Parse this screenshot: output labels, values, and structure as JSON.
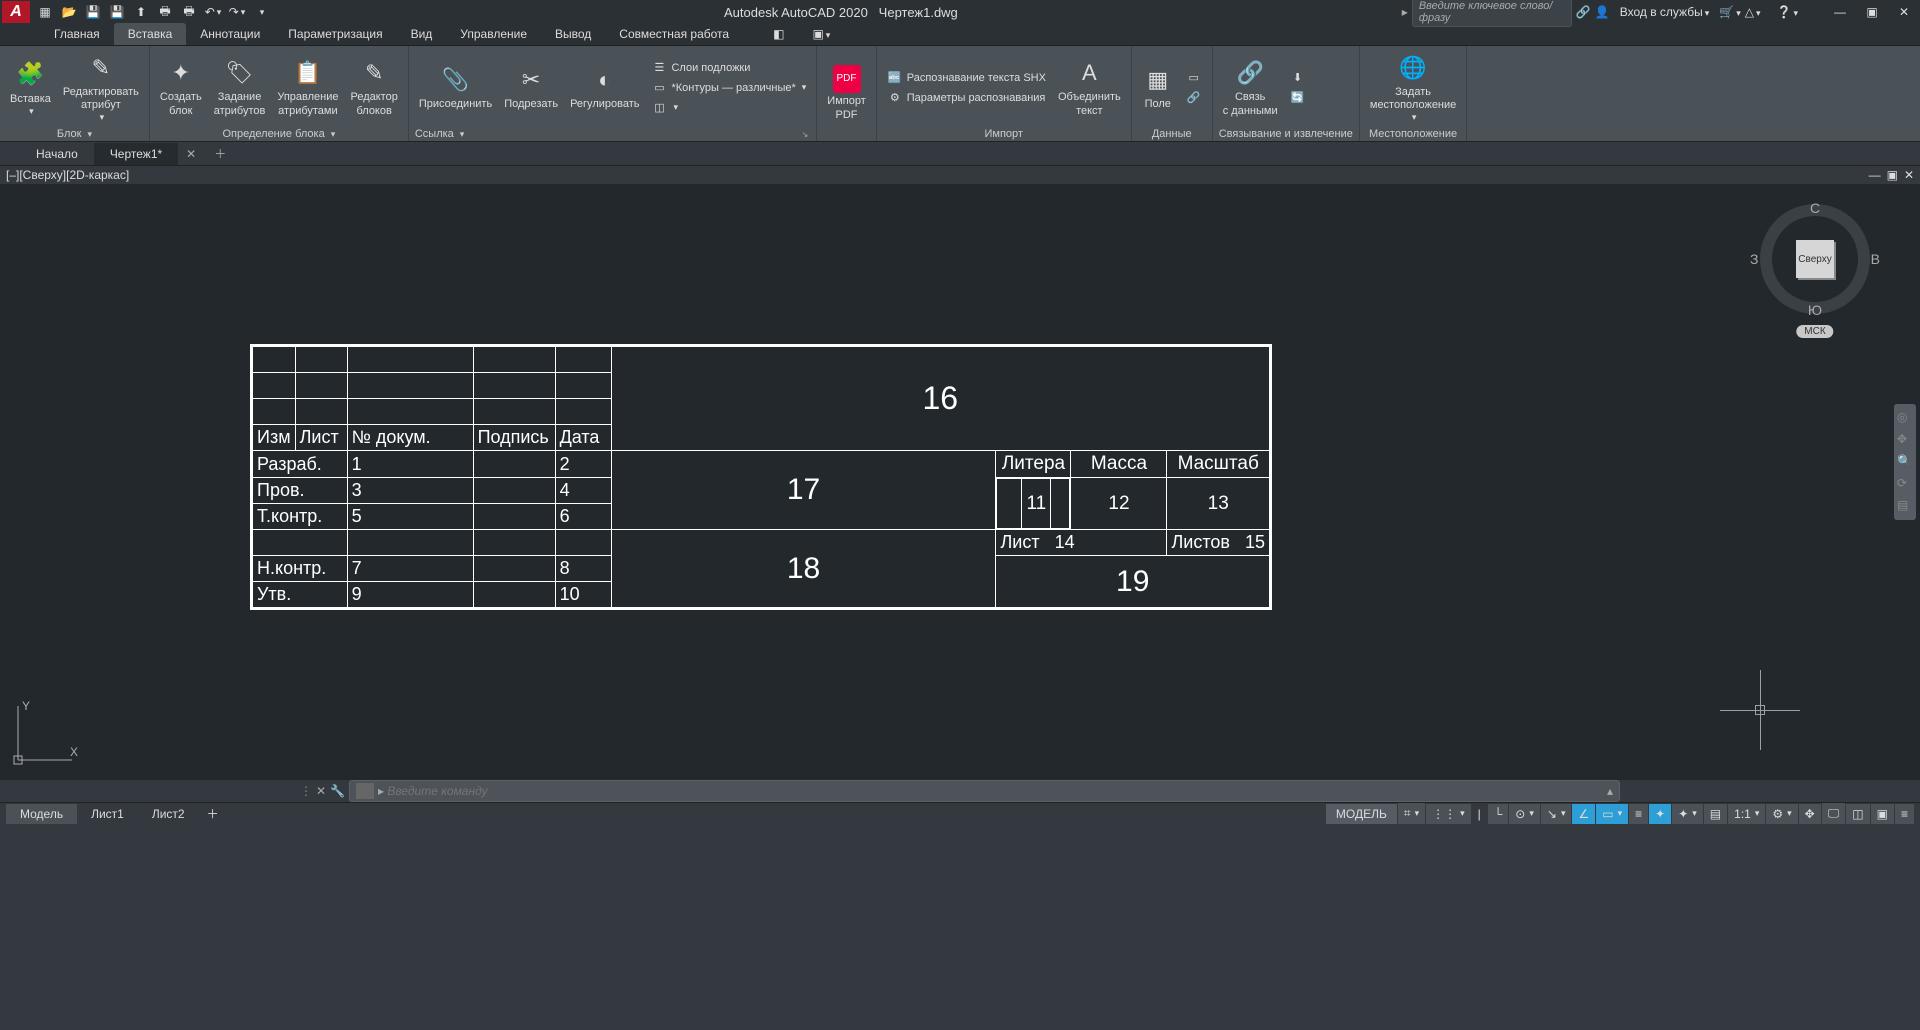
{
  "titlebar": {
    "app": "Autodesk AutoCAD 2020",
    "file": "Чертеж1.dwg",
    "search_placeholder": "Введите ключевое слово/фразу",
    "signin": "Вход в службы"
  },
  "ribbon_tabs": [
    "Главная",
    "Вставка",
    "Аннотации",
    "Параметризация",
    "Вид",
    "Управление",
    "Вывод",
    "Совместная работа"
  ],
  "active_ribbon_tab_index": 1,
  "ribbon": {
    "block": {
      "insert": "Вставка",
      "edit_attr": "Редактировать\nатрибут",
      "panel": "Блок"
    },
    "def": {
      "create": "Создать\nблок",
      "defattr": "Задание\nатрибутов",
      "manattr": "Управление\nатрибутами",
      "bedit": "Редактор\nблоков",
      "panel": "Определение блока"
    },
    "ref": {
      "attach": "Присоединить",
      "clip": "Подрезать",
      "adjust": "Регулировать",
      "underlay": "Слои подложки",
      "frames": "*Контуры — различные*",
      "panel": "Ссылка"
    },
    "pdf": {
      "import": "Импорт\nPDF"
    },
    "import": {
      "shx": "Распознавание текста SHX",
      "settings": "Параметры распознавания",
      "combine": "Объединить\nтекст",
      "panel": "Импорт"
    },
    "field": {
      "field": "Поле",
      "panel": "Данные"
    },
    "link": {
      "datalink": "Связь\nс данными",
      "panel": "Связывание и извлечение"
    },
    "loc": {
      "setloc": "Задать\nместоположение",
      "panel": "Местоположение"
    }
  },
  "filetabs": {
    "start": "Начало",
    "active": "Чертеж1*"
  },
  "viewport": {
    "label": "[–][Сверху][2D-каркас]",
    "cube": "Сверху",
    "compass": {
      "n": "С",
      "s": "Ю",
      "e": "В",
      "w": "З"
    },
    "wcs": "МСК"
  },
  "block_table": {
    "izm": "Изм",
    "list": "Лист",
    "docno": "№ докум.",
    "sign": "Подпись",
    "date": "Дата",
    "rows": [
      {
        "role": "Разраб.",
        "d": "1",
        "dt": "2"
      },
      {
        "role": "Пров.",
        "d": "3",
        "dt": "4"
      },
      {
        "role": "Т.контр.",
        "d": "5",
        "dt": "6"
      },
      {
        "role": "",
        "d": "",
        "dt": ""
      },
      {
        "role": "Н.контр.",
        "d": "7",
        "dt": "8"
      },
      {
        "role": "Утв.",
        "d": "9",
        "dt": "10"
      }
    ],
    "sixteen": "16",
    "seventeen": "17",
    "eighteen": "18",
    "nineteen": "19",
    "litera": "Литера",
    "massa": "Масса",
    "scale": "Масштаб",
    "lit_v": "11",
    "mass_v": "12",
    "scale_v": "13",
    "sheet": "Лист",
    "sheet_v": "14",
    "sheets": "Листов",
    "sheets_v": "15"
  },
  "cmd": {
    "placeholder": "Введите команду"
  },
  "layout": {
    "model": "Модель",
    "l1": "Лист1",
    "l2": "Лист2"
  },
  "status": {
    "model": "МОДЕЛЬ",
    "scale": "1:1"
  }
}
